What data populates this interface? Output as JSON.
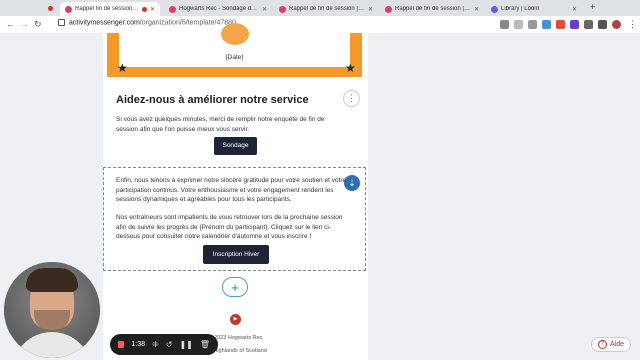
{
  "browser": {
    "tabs": [
      {
        "label": "Rappel fin de session | Ga",
        "active": true,
        "color": "#e03c6a"
      },
      {
        "label": "Hogwarts Rec - Sondage de fi",
        "active": false,
        "color": "#e03c6a"
      },
      {
        "label": "Rappel de fin de session | Tâc",
        "active": false,
        "color": "#e03c6a"
      },
      {
        "label": "Rappel de fin de session | Tâc",
        "active": false,
        "color": "#e03c6a"
      },
      {
        "label": "Library | Loom",
        "active": false,
        "color": "#625df5"
      }
    ],
    "url_host": "activitymessenger.com",
    "url_path": "/organization/5/template/47880"
  },
  "certificate": {
    "date": "{Date}"
  },
  "survey": {
    "title": "Aidez-nous à améliorer notre service",
    "text": "Si vous avez quelques minutes, merci de remplir notre enquête de fin de session afin que l'on puisse mieux vous servir.",
    "button": "Sondage"
  },
  "closing": {
    "para1": "Enfin, nous tenons à exprimer notre sincère gratitude pour votre soutien et votre participation continus. Votre enthousiasme et votre engagement rendent les sessions dynamiques et agréables pour tous les participants.",
    "para2": "Nos entraîneurs sont impatients de vous retrouver lors de la prochaine session afin de suivre les progrès de {Prénom du participant}. Cliquez sur le lien ci-dessous pour consulter notre calendrier d'automne et vous inscrire !",
    "button": "Inscription Hiver"
  },
  "footer": {
    "line1": "© 2023 Hogwarts Rec",
    "line2": "the Highlands of Scotland"
  },
  "recorder": {
    "time": "1:38"
  },
  "help": {
    "label": "Aide"
  }
}
